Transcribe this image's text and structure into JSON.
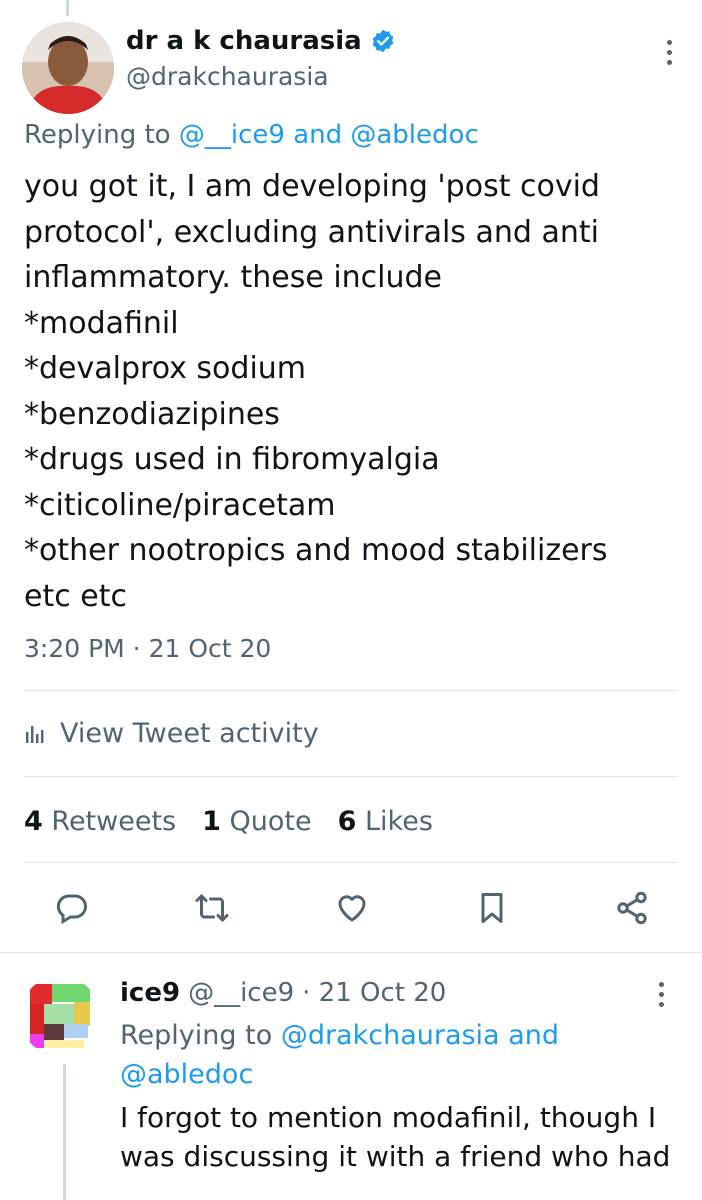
{
  "tweet": {
    "display_name": "dr a k chaurasia",
    "handle": "@drakchaurasia",
    "replying_prefix": "Replying to",
    "replying_user1": "@__ice9",
    "replying_and": "and",
    "replying_user2": "@abledoc",
    "lines": [
      "you got it, I am developing 'post covid",
      "protocol', excluding antivirals and anti",
      "inflammatory. these include",
      "*modafinil",
      "*devalprox sodium",
      "*benzodiazipines",
      "*drugs used in fibromyalgia",
      "*citicoline/piracetam",
      "*other nootropics and mood stabilizers",
      "etc etc"
    ],
    "timestamp": "3:20 PM · 21 Oct 20",
    "activity_label": "View Tweet activity",
    "stats": {
      "retweets_count": "4",
      "retweets_label": "Retweets",
      "quotes_count": "1",
      "quotes_label": "Quote",
      "likes_count": "6",
      "likes_label": "Likes"
    },
    "icons": [
      "reply-icon",
      "retweet-icon",
      "like-icon",
      "bookmark-icon",
      "share-icon"
    ]
  },
  "reply": {
    "display_name": "ice9",
    "handle": "@__ice9",
    "date": "· 21 Oct 20",
    "replying_prefix": "Replying to",
    "replying_user1": "@drakchaurasia",
    "replying_and": "and",
    "replying_user2": "@abledoc",
    "lines": [
      "I forgot to mention modafinil, though I",
      "was discussing it with a friend who had"
    ]
  },
  "colors": {
    "link": "#1d9bf0",
    "muted": "#536471",
    "text": "#0f1419",
    "verified": "#1d9bf0"
  }
}
